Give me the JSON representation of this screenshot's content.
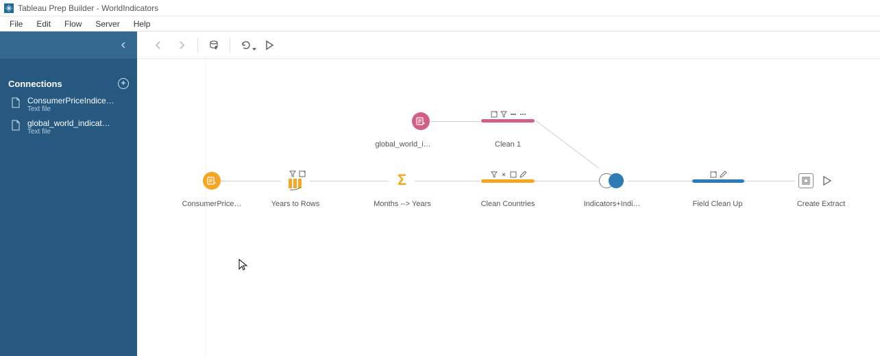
{
  "titlebar": {
    "text": "Tableau Prep Builder - WorldIndicators"
  },
  "menu": {
    "file": "File",
    "edit": "Edit",
    "flow": "Flow",
    "server": "Server",
    "help": "Help"
  },
  "sidebar": {
    "header": "Connections",
    "items": [
      {
        "name": "ConsumerPriceIndice…",
        "sub": "Text file"
      },
      {
        "name": "global_world_indicat…",
        "sub": "Text file"
      }
    ]
  },
  "nodes": {
    "consumer": "ConsumerPrice…",
    "years": "Years to Rows",
    "months": "Months --> Years",
    "cleanCountries": "Clean Countries",
    "global": "global_world_i…",
    "clean1": "Clean 1",
    "join": "Indicators+Indi…",
    "cleanup": "Field Clean Up",
    "extract": "Create Extract"
  },
  "colors": {
    "orange": "#f5a623",
    "pink": "#d15f87",
    "blue": "#2d7cb8"
  }
}
